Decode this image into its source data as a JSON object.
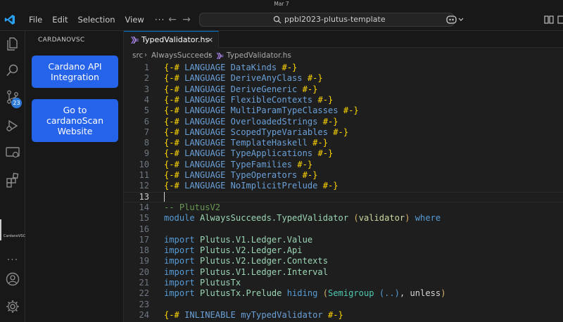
{
  "os": {
    "date": "Mar 7"
  },
  "titlebar": {
    "menu": [
      "File",
      "Edit",
      "Selection",
      "View"
    ],
    "more": "···",
    "search_text": "ppbl2023-plutus-template"
  },
  "activity": {
    "scm_badge": "23",
    "extension_label": "CardanoVSC"
  },
  "sidebar": {
    "title": "CARDANOVSC",
    "buttons": [
      {
        "lines": [
          "Cardano API",
          "Integration"
        ]
      },
      {
        "lines": [
          "Go to",
          "cardanoScan",
          "Website"
        ]
      }
    ]
  },
  "tab": {
    "label": "TypedValidator.hs",
    "close": "×"
  },
  "breadcrumb": [
    "src",
    "AlwaysSucceeds",
    "TypedValidator.hs"
  ],
  "editor": {
    "current_line": 13,
    "lines": [
      {
        "n": "1",
        "tokens": [
          [
            "{-#",
            "c-yellow"
          ],
          [
            " LANGUAGE DataKinds ",
            "c-pragma"
          ],
          [
            "#-}",
            "c-yellow"
          ]
        ]
      },
      {
        "n": "2",
        "tokens": [
          [
            "{-#",
            "c-yellow"
          ],
          [
            " LANGUAGE DeriveAnyClass ",
            "c-pragma"
          ],
          [
            "#-}",
            "c-yellow"
          ]
        ]
      },
      {
        "n": "3",
        "tokens": [
          [
            "{-#",
            "c-yellow"
          ],
          [
            " LANGUAGE DeriveGeneric ",
            "c-pragma"
          ],
          [
            "#-}",
            "c-yellow"
          ]
        ]
      },
      {
        "n": "4",
        "tokens": [
          [
            "{-#",
            "c-yellow"
          ],
          [
            " LANGUAGE FlexibleContexts ",
            "c-pragma"
          ],
          [
            "#-}",
            "c-yellow"
          ]
        ]
      },
      {
        "n": "5",
        "tokens": [
          [
            "{-#",
            "c-yellow"
          ],
          [
            " LANGUAGE MultiParamTypeClasses ",
            "c-pragma"
          ],
          [
            "#-}",
            "c-yellow"
          ]
        ]
      },
      {
        "n": "6",
        "tokens": [
          [
            "{-#",
            "c-yellow"
          ],
          [
            " LANGUAGE OverloadedStrings ",
            "c-pragma"
          ],
          [
            "#-}",
            "c-yellow"
          ]
        ]
      },
      {
        "n": "7",
        "tokens": [
          [
            "{-#",
            "c-yellow"
          ],
          [
            " LANGUAGE ScopedTypeVariables ",
            "c-pragma"
          ],
          [
            "#-}",
            "c-yellow"
          ]
        ]
      },
      {
        "n": "8",
        "tokens": [
          [
            "{-#",
            "c-yellow"
          ],
          [
            " LANGUAGE TemplateHaskell ",
            "c-pragma"
          ],
          [
            "#-}",
            "c-yellow"
          ]
        ]
      },
      {
        "n": "9",
        "tokens": [
          [
            "{-#",
            "c-yellow"
          ],
          [
            " LANGUAGE TypeApplications ",
            "c-pragma"
          ],
          [
            "#-}",
            "c-yellow"
          ]
        ]
      },
      {
        "n": "10",
        "tokens": [
          [
            "{-#",
            "c-yellow"
          ],
          [
            " LANGUAGE TypeFamilies ",
            "c-pragma"
          ],
          [
            "#-}",
            "c-yellow"
          ]
        ]
      },
      {
        "n": "11",
        "tokens": [
          [
            "{-#",
            "c-yellow"
          ],
          [
            " LANGUAGE TypeOperators ",
            "c-pragma"
          ],
          [
            "#-}",
            "c-yellow"
          ]
        ]
      },
      {
        "n": "12",
        "tokens": [
          [
            "{-#",
            "c-yellow"
          ],
          [
            " LANGUAGE NoImplicitPrelude ",
            "c-pragma"
          ],
          [
            "#-}",
            "c-yellow"
          ]
        ]
      },
      {
        "n": "13",
        "tokens": []
      },
      {
        "n": "14",
        "tokens": [
          [
            "-- PlutusV2",
            "c-comment"
          ]
        ]
      },
      {
        "n": "15",
        "tokens": [
          [
            "module",
            "c-kw"
          ],
          [
            " AlwaysSucceeds.TypedValidator ",
            "c-mod"
          ],
          [
            "(",
            "c-paren"
          ],
          [
            "validator",
            "c-id"
          ],
          [
            ")",
            "c-paren"
          ],
          [
            " where",
            "c-kw"
          ]
        ]
      },
      {
        "n": "16",
        "tokens": []
      },
      {
        "n": "17",
        "tokens": [
          [
            "import",
            "c-kw"
          ],
          [
            " Plutus.V1.Ledger.Value",
            "c-mod"
          ]
        ]
      },
      {
        "n": "18",
        "tokens": [
          [
            "import",
            "c-kw"
          ],
          [
            " Plutus.V2.Ledger.Api",
            "c-mod"
          ]
        ]
      },
      {
        "n": "19",
        "tokens": [
          [
            "import",
            "c-kw"
          ],
          [
            " Plutus.V2.Ledger.Contexts",
            "c-mod"
          ]
        ]
      },
      {
        "n": "20",
        "tokens": [
          [
            "import",
            "c-kw"
          ],
          [
            " Plutus.V1.Ledger.Interval",
            "c-mod"
          ]
        ]
      },
      {
        "n": "21",
        "tokens": [
          [
            "import",
            "c-kw"
          ],
          [
            " PlutusTx",
            "c-mod"
          ]
        ]
      },
      {
        "n": "22",
        "tokens": [
          [
            "import",
            "c-kw"
          ],
          [
            " PlutusTx.Prelude ",
            "c-mod"
          ],
          [
            "hiding",
            "c-kw"
          ],
          [
            " ",
            "c-plain"
          ],
          [
            "(",
            "c-paren"
          ],
          [
            "Semigroup",
            "c-type"
          ],
          [
            " ",
            "c-plain"
          ],
          [
            "(..)",
            "c-kw"
          ],
          [
            ", unless",
            "c-plain"
          ],
          [
            ")",
            "c-paren"
          ]
        ]
      },
      {
        "n": "23",
        "tokens": []
      },
      {
        "n": "24",
        "tokens": [
          [
            "{-#",
            "c-yellow"
          ],
          [
            " INLINEABLE myTypedValidator ",
            "c-pragma"
          ],
          [
            "#-}",
            "c-yellow"
          ]
        ]
      }
    ]
  }
}
